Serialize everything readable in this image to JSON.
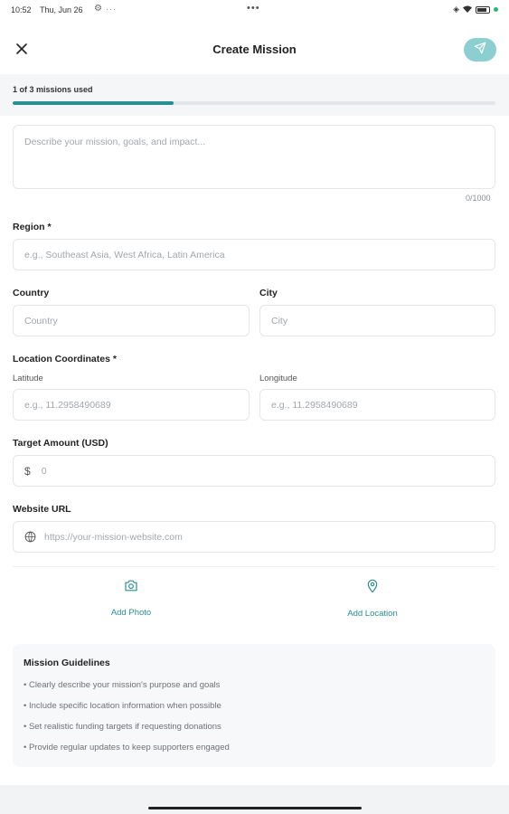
{
  "status_bar": {
    "time": "10:52",
    "date": "Thu, Jun 26",
    "more": "•••",
    "icons": [
      "settings-icon",
      "wifi-icon",
      "battery-icon"
    ]
  },
  "header": {
    "title": "Create Mission",
    "close_icon": "close-icon",
    "send_icon": "send-icon"
  },
  "usage": {
    "label": "1 of 3 missions used",
    "progress": 0.334,
    "accent": "#2a8f92"
  },
  "form": {
    "description": {
      "placeholder": "Describe your mission, goals, and impact...",
      "counter": "0/1000"
    },
    "region": {
      "label": "Region *",
      "placeholder": "e.g., Southeast Asia, West Africa, Latin America"
    },
    "country": {
      "label": "Country",
      "placeholder": "Country"
    },
    "city": {
      "label": "City",
      "placeholder": "City"
    },
    "coordinates": {
      "label": "Location Coordinates *",
      "latitude_label": "Latitude",
      "latitude_placeholder": "e.g., 11.2958490689",
      "longitude_label": "Longitude",
      "longitude_placeholder": "e.g., 11.2958490689"
    },
    "target": {
      "label": "Target Amount (USD)",
      "currency": "$",
      "placeholder": "0"
    },
    "website": {
      "label": "Website URL",
      "placeholder": "https://your-mission-website.com",
      "icon": "globe-icon"
    }
  },
  "actions": {
    "add_photo": "Add Photo",
    "add_location": "Add Location"
  },
  "guidelines": {
    "title": "Mission Guidelines",
    "items": [
      "• Clearly describe your mission's purpose and goals",
      "• Include specific location information when possible",
      "• Set realistic funding targets if requesting donations",
      "• Provide regular updates to keep supporters engaged"
    ]
  },
  "colors": {
    "accent": "#2a8f92",
    "send_button": "#8ccfd0",
    "border": "#e3e7ea"
  }
}
